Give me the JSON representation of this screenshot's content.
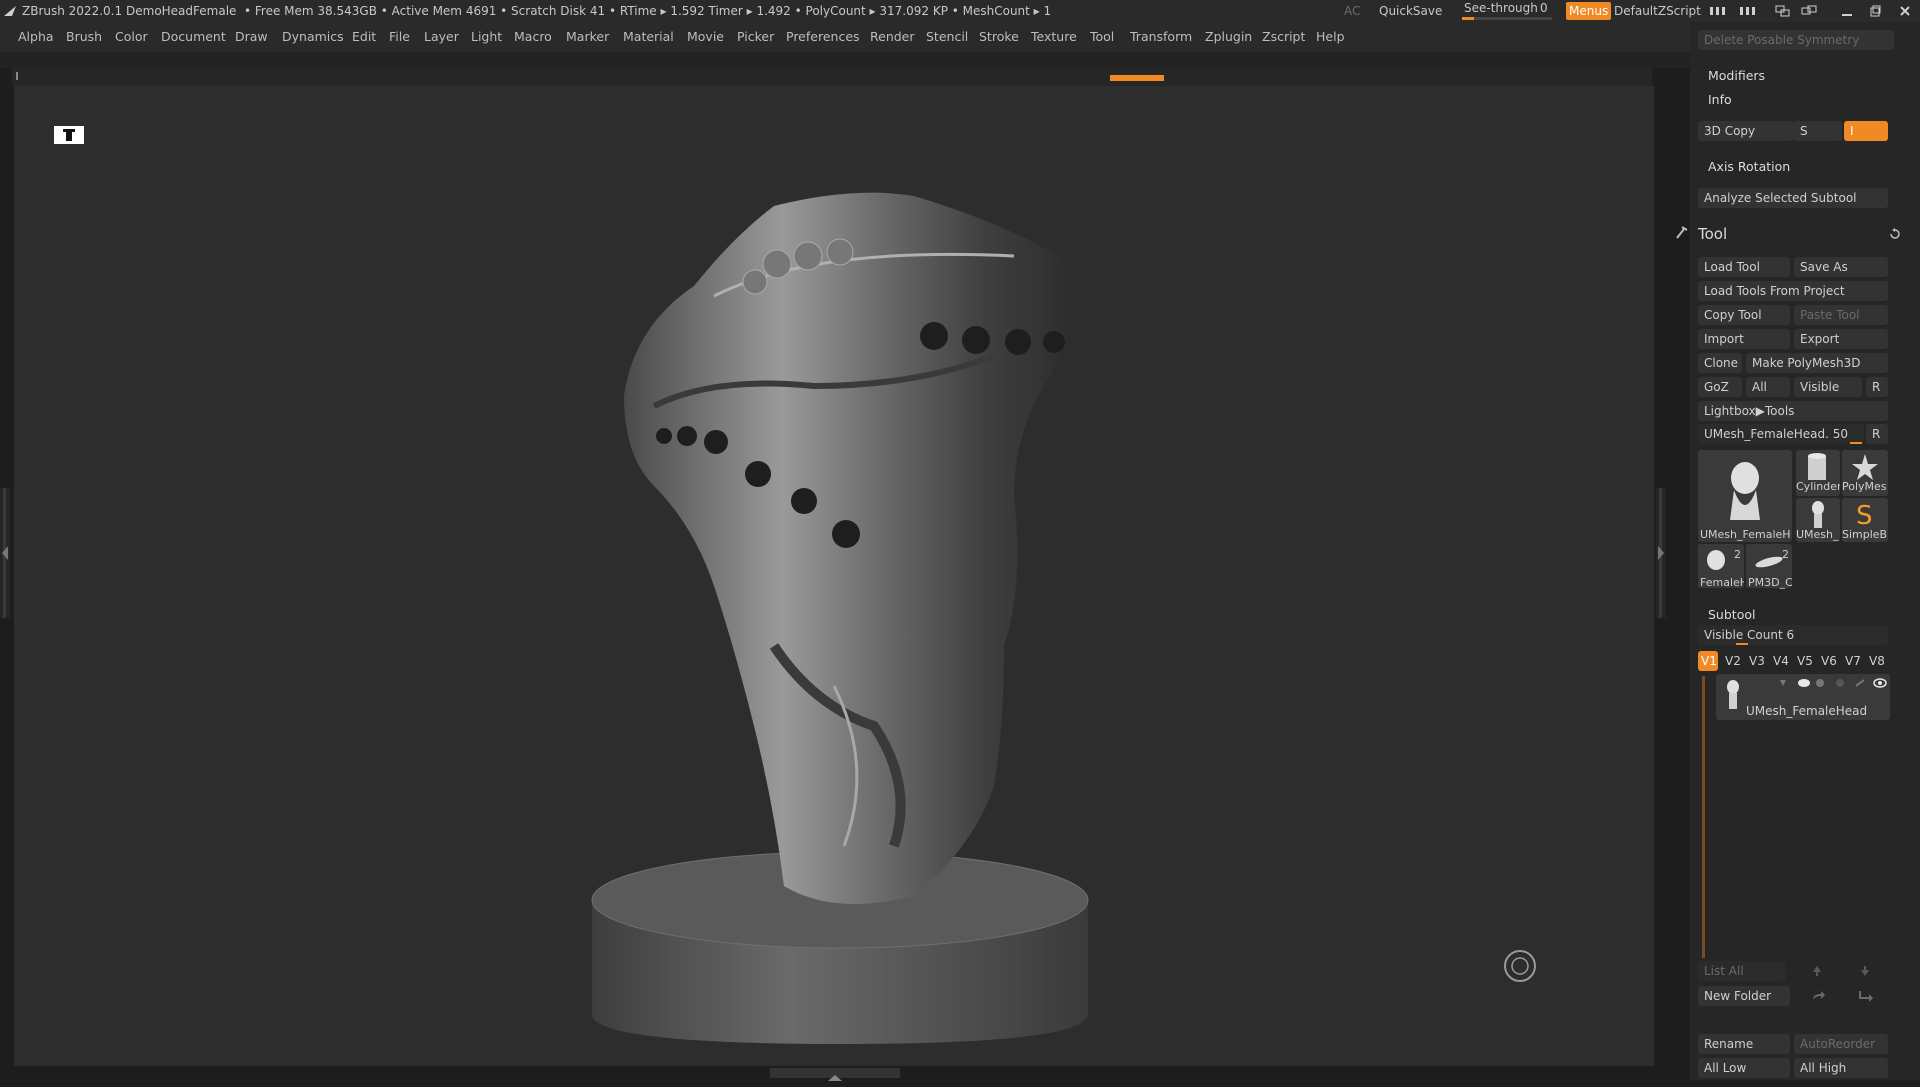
{
  "titlebar": {
    "app": "ZBrush 2022.0.1",
    "doc": "DemoHeadFemale",
    "stats": "• Free Mem 38.543GB • Active Mem 4691 • Scratch Disk 41 • RTime ▸ 1.592 Timer ▸ 1.492 • PolyCount ▸ 317.092 KP • MeshCount ▸ 1",
    "ac": "AC",
    "quicksave": "QuickSave",
    "seethrough": "See-through",
    "seethrough_value": "0",
    "menus": "Menus",
    "script": "DefaultZScript"
  },
  "menu": [
    "Alpha",
    "Brush",
    "Color",
    "Document",
    "Draw",
    "Dynamics",
    "Edit",
    "File",
    "Layer",
    "Light",
    "Macro",
    "Marker",
    "Material",
    "Movie",
    "Picker",
    "Preferences",
    "Render",
    "Stencil",
    "Stroke",
    "Texture",
    "Tool",
    "Transform",
    "Zplugin",
    "Zscript",
    "Help"
  ],
  "panel": {
    "delete_posable": "Delete Posable Symmetry",
    "modifiers": "Modifiers",
    "info": "Info",
    "copy3d": "3D Copy",
    "s": "S",
    "i": "I",
    "axis_rotation": "Axis Rotation",
    "analyze": "Analyze Selected Subtool",
    "tool_title": "Tool",
    "load_tool": "Load Tool",
    "save_as": "Save As",
    "load_from_project": "Load Tools From Project",
    "copy_tool": "Copy Tool",
    "paste_tool": "Paste Tool",
    "import": "Import",
    "export": "Export",
    "clone": "Clone",
    "make_polymesh": "Make PolyMesh3D",
    "goz": "GoZ",
    "all": "All",
    "visible": "Visible",
    "r": "R",
    "lightbox_tools": "Lightbox▶Tools",
    "current_tool": "UMesh_FemaleHead. 50",
    "thumbs": {
      "big": "UMesh_FemaleH",
      "cylinder": "Cylinder",
      "polymesh": "PolyMes",
      "umesh_small": "UMesh_",
      "simpleb": "SimpleB",
      "femaleh": "FemaleH",
      "pm3d": "PM3D_C",
      "count1": "2",
      "count2": "2"
    },
    "subtool": "Subtool",
    "visible_count": "Visible Count 6",
    "vtabs": [
      "V1",
      "V2",
      "V3",
      "V4",
      "V5",
      "V6",
      "V7",
      "V8"
    ],
    "subtool_item": "UMesh_FemaleHead",
    "list_all": "List All",
    "new_folder": "New Folder",
    "rename": "Rename",
    "autoreorder": "AutoReorder",
    "all_low": "All Low",
    "all_high": "All High"
  },
  "colors": {
    "accent": "#f08a24",
    "bg": "#2d2d2d",
    "panel": "#262626"
  }
}
